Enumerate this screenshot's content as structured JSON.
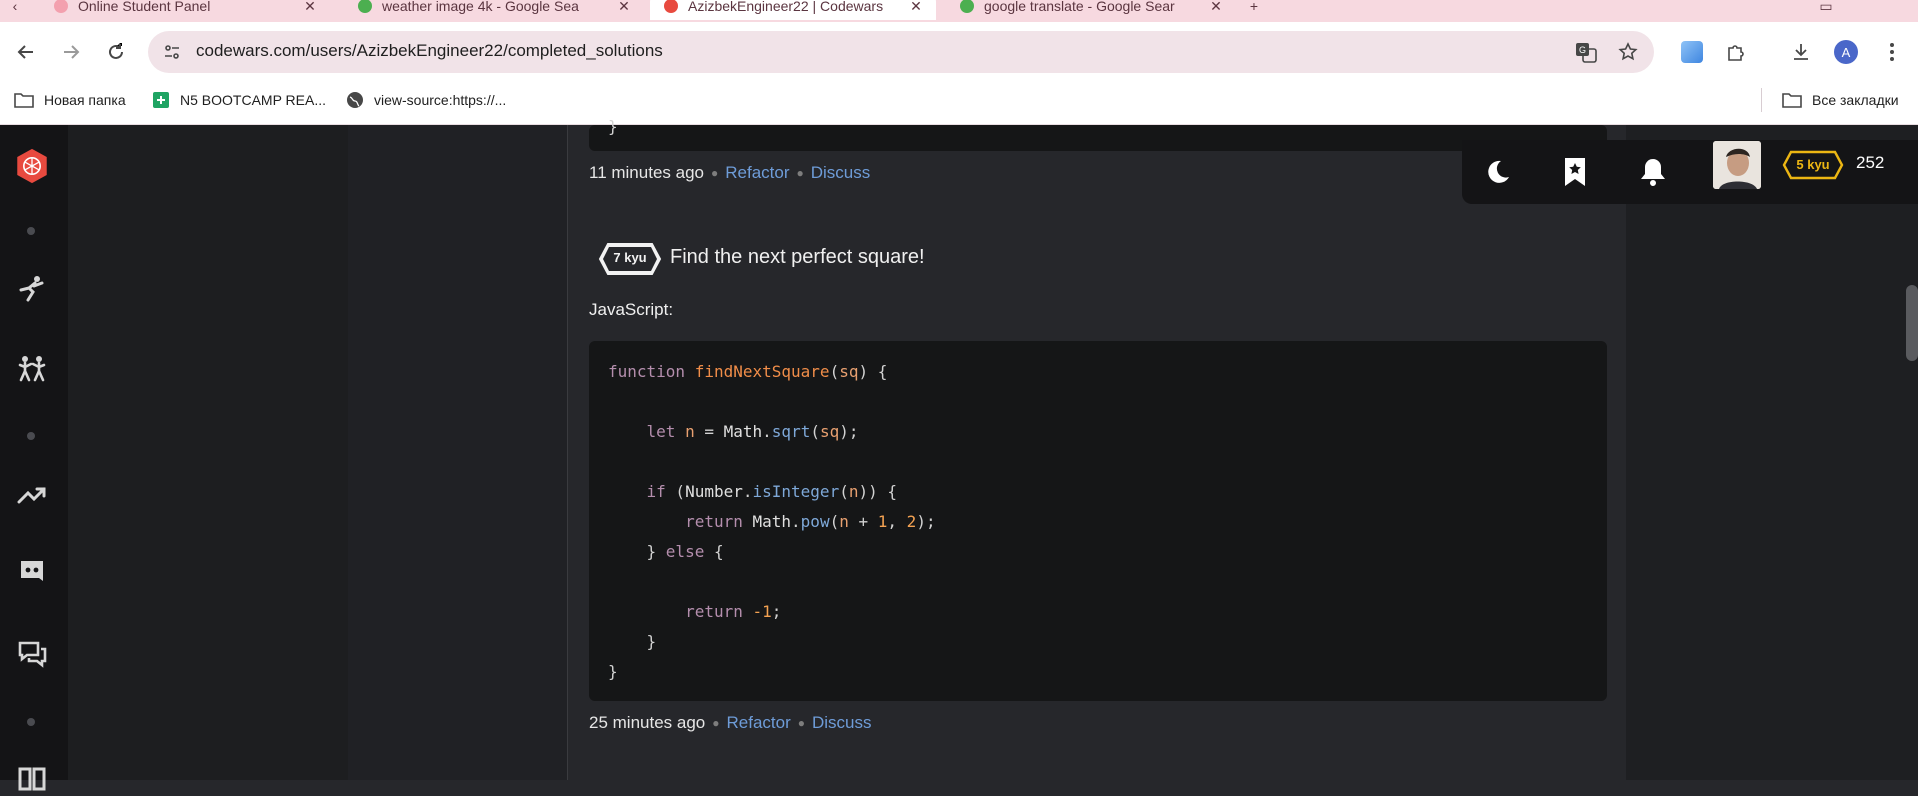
{
  "browser": {
    "tabs": [
      {
        "title": "Online Student Panel",
        "active": false
      },
      {
        "title": "weather image 4k - Google Sea",
        "active": false
      },
      {
        "title": "AzizbekEngineer22 | Codewars",
        "active": true
      },
      {
        "title": "google translate - Google Sear",
        "active": false
      }
    ],
    "url": "codewars.com/users/AzizbekEngineer22/completed_solutions",
    "profile_initial": "A",
    "bookmarks": [
      {
        "label": "Новая папка"
      },
      {
        "label": "N5 BOOTCAMP REA..."
      },
      {
        "label": "view-source:https://..."
      }
    ],
    "all_bookmarks": "Все закладки"
  },
  "user": {
    "rank": "5 kyu",
    "honor": "252"
  },
  "solutions": [
    {
      "time": "11 minutes ago",
      "refactor": "Refactor",
      "discuss": "Discuss"
    },
    {
      "kyu": "7 kyu",
      "title": "Find the next perfect square!",
      "language": "JavaScript:",
      "time": "25 minutes ago",
      "refactor": "Refactor",
      "discuss": "Discuss"
    }
  ],
  "colors": {
    "accent_red": "#e84a3f",
    "rank_yellow": "#ecb613",
    "link_blue": "#6e9cd8"
  }
}
